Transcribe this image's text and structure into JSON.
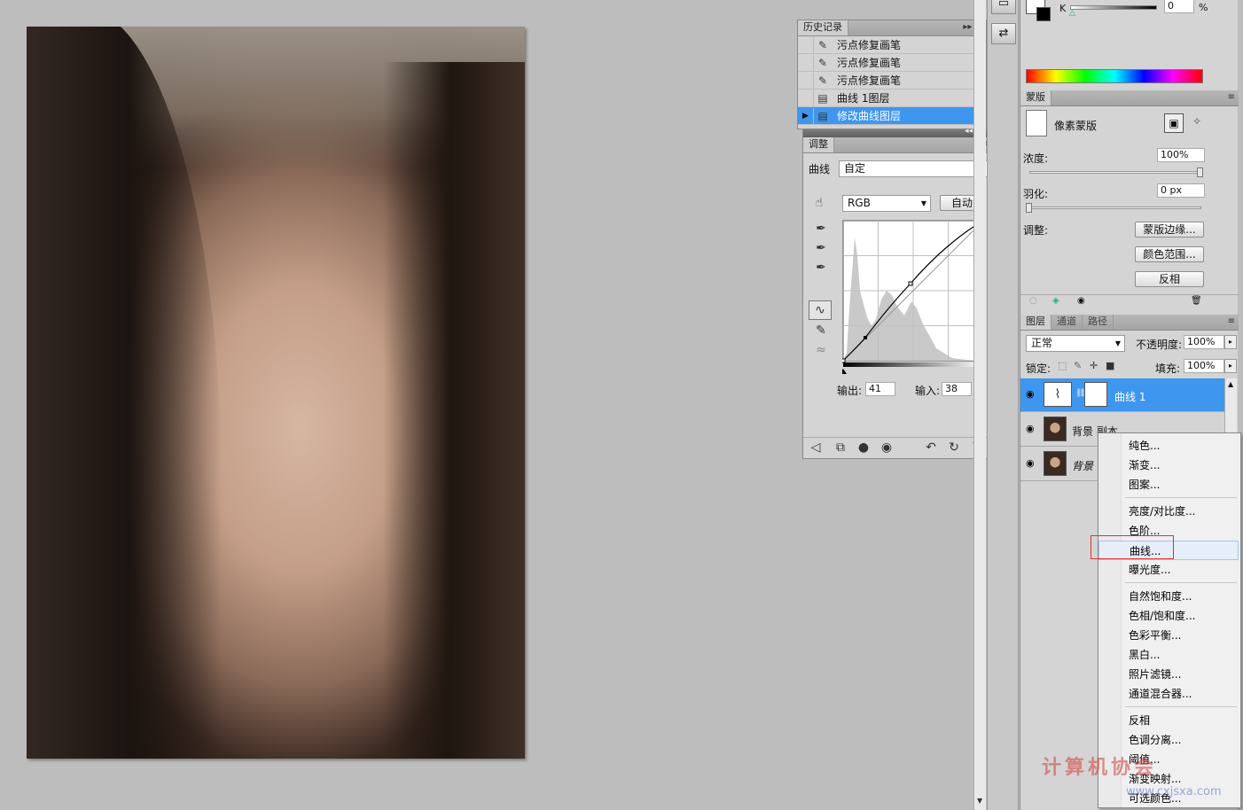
{
  "history": {
    "tab": "历史记录",
    "items": [
      {
        "label": "污点修复画笔",
        "selected": false
      },
      {
        "label": "污点修复画笔",
        "selected": false
      },
      {
        "label": "污点修复画笔",
        "selected": false
      },
      {
        "label": "曲线 1图层",
        "selected": false
      },
      {
        "label": "修改曲线图层",
        "selected": true
      }
    ]
  },
  "adjustments": {
    "tab": "调整",
    "curve_label": "曲线",
    "preset": "自定",
    "channel": "RGB",
    "auto_button": "自动",
    "output_label": "输出:",
    "output_value": "41",
    "input_label": "输入:",
    "input_value": "38"
  },
  "color": {
    "k_label": "K",
    "k_value": "0",
    "k_unit": "%"
  },
  "masks": {
    "tab": "蒙版",
    "pixel_mask": "像素蒙版",
    "density_label": "浓度:",
    "density_value": "100%",
    "feather_label": "羽化:",
    "feather_value": "0 px",
    "refine_label": "调整:",
    "mask_edge_button": "蒙版边缘...",
    "color_range_button": "颜色范围...",
    "invert_button": "反相"
  },
  "layers": {
    "tabs": [
      "图层",
      "通道",
      "路径"
    ],
    "blend_mode": "正常",
    "opacity_label": "不透明度:",
    "opacity_value": "100%",
    "lock_label": "锁定:",
    "fill_label": "填充:",
    "fill_value": "100%",
    "items": [
      {
        "name": "曲线 1",
        "selected": true
      },
      {
        "name": "背景 副本",
        "selected": false
      },
      {
        "name": "背景",
        "selected": false
      }
    ]
  },
  "context_menu": {
    "groups": [
      [
        "纯色...",
        "渐变...",
        "图案..."
      ],
      [
        "亮度/对比度...",
        "色阶...",
        "曲线...",
        "曝光度..."
      ],
      [
        "自然饱和度...",
        "色相/饱和度...",
        "色彩平衡...",
        "黑白...",
        "照片滤镜...",
        "通道混合器..."
      ],
      [
        "反相",
        "色调分离...",
        "阈值...",
        "渐变映射...",
        "可选颜色..."
      ]
    ],
    "highlighted": "曲线..."
  },
  "watermark": {
    "text": "计算机协会",
    "url": "www.cxjsxa.com"
  }
}
